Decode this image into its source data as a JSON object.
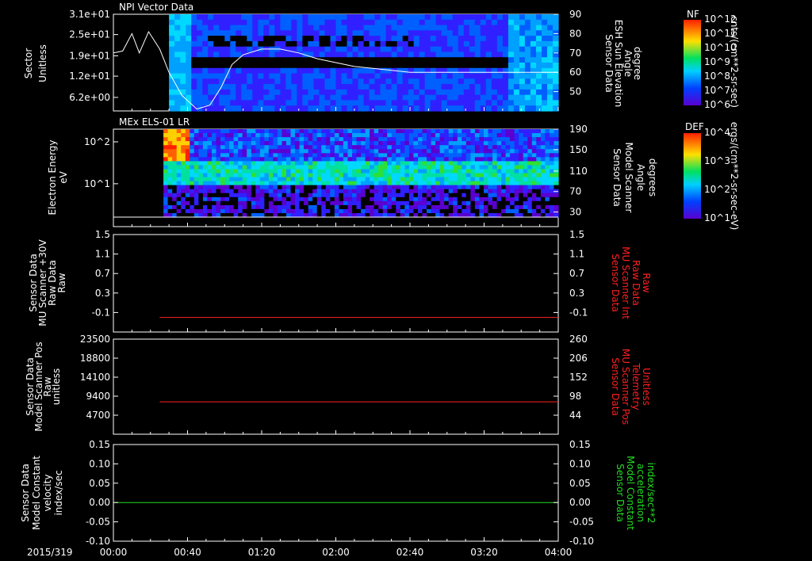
{
  "date_label": "2015/319",
  "time_ticks": [
    "00:00",
    "00:40",
    "01:20",
    "02:00",
    "02:40",
    "03:20",
    "04:00"
  ],
  "colors": {
    "white": "#ffffff",
    "red": "#ff2020",
    "green": "#22dd22"
  },
  "chart_data": [
    {
      "type": "heatmap",
      "title": "NPI Vector Data",
      "ylabel_left": [
        "Sector",
        "Unitless"
      ],
      "yticks_left": [
        "3.1e+01",
        "2.5e+01",
        "1.9e+01",
        "1.2e+01",
        "6.2e+00"
      ],
      "ylabel_right": [
        "Sensor Data",
        "ESH Sun Elevation",
        "Angle",
        "degree"
      ],
      "yticks_right": [
        "90",
        "80",
        "70",
        "60",
        "50"
      ],
      "ylim_right": [
        40,
        90
      ],
      "data_start_time": "00:30",
      "line_series": {
        "name": "ESH Sun Elevation Angle",
        "x": [
          "00:00",
          "00:05",
          "00:10",
          "00:14",
          "00:19",
          "00:25",
          "00:30",
          "00:37",
          "00:45",
          "00:52",
          "00:58",
          "01:04",
          "01:10",
          "01:20",
          "01:30",
          "01:40",
          "01:50",
          "02:00",
          "02:10",
          "02:20",
          "02:30",
          "02:40",
          "03:00",
          "03:20",
          "04:00"
        ],
        "y": [
          70,
          71,
          80,
          70,
          81,
          72,
          60,
          48,
          41,
          43,
          52,
          64,
          69,
          72,
          72,
          70,
          67,
          65,
          63,
          62,
          61,
          60,
          60,
          60,
          60
        ]
      },
      "colorbar": {
        "label": "NF",
        "unit": "cnts/(cm**2-sr-sec)",
        "ticks": [
          "10^12",
          "10^11",
          "10^10",
          "10^9",
          "10^8",
          "10^7",
          "10^6"
        ]
      }
    },
    {
      "type": "heatmap",
      "title": "MEx ELS-01 LR",
      "ylabel_left": [
        "Electron Energy",
        "eV"
      ],
      "yticks_left": [
        "10^2",
        "10^1"
      ],
      "ylabel_right": [
        "Sensor Data",
        "Model Scanner",
        "Angle",
        "degrees"
      ],
      "yticks_right": [
        "190",
        "150",
        "110",
        "70",
        "30"
      ],
      "data_start_time": "00:27",
      "colorbar": {
        "label": "DEF",
        "unit": "ergs/(cm**2-sr-sec-eV)",
        "ticks": [
          "10^4",
          "10^3",
          "10^2",
          "10^1"
        ]
      }
    },
    {
      "type": "line",
      "ylabel_left": [
        "Sensor Data",
        "MU Scanner +30V",
        "Raw Data",
        "Raw"
      ],
      "yticks_left": [
        "1.5",
        "1.1",
        "0.7",
        "0.3",
        "-0.1"
      ],
      "ylim": [
        -0.3,
        1.5
      ],
      "ylabel_right": [
        "Sensor Data",
        "MU Scanner Int",
        "Raw Data",
        "Raw"
      ],
      "yticks_right": [
        "1.5",
        "1.1",
        "0.7",
        "0.3",
        "-0.1"
      ],
      "series": [
        {
          "x_start": "00:25",
          "x_end": "04:00",
          "value": -0.03
        }
      ]
    },
    {
      "type": "line",
      "ylabel_left": [
        "Sensor Data",
        "Model Scanner Pos",
        "Raw",
        "unitless"
      ],
      "yticks_left": [
        "23500",
        "18800",
        "14100",
        "9400",
        "4700"
      ],
      "ylim": [
        0,
        23500
      ],
      "ylabel_right": [
        "Sensor Data",
        "MU Scanner Pos",
        "Telemetry",
        "Unitless"
      ],
      "yticks_right": [
        "260",
        "206",
        "152",
        "98",
        "44"
      ],
      "series": [
        {
          "x_start": "00:25",
          "x_end": "04:00",
          "value": 8000
        }
      ]
    },
    {
      "type": "line",
      "ylabel_left": [
        "Sensor Data",
        "Model Constant",
        "velocity",
        "index/sec"
      ],
      "yticks_left": [
        "0.15",
        "0.10",
        "0.05",
        "0.00",
        "-0.05",
        "-0.10"
      ],
      "ylim": [
        -0.1,
        0.15
      ],
      "ylabel_right": [
        "Sensor Data",
        "Model Constant",
        "acceleration",
        "index/sec**2"
      ],
      "yticks_right": [
        "0.15",
        "0.10",
        "0.05",
        "0.00",
        "-0.05",
        "-0.10"
      ],
      "series": [
        {
          "x_start": "00:00",
          "x_end": "04:00",
          "value": 0.0
        }
      ]
    }
  ]
}
